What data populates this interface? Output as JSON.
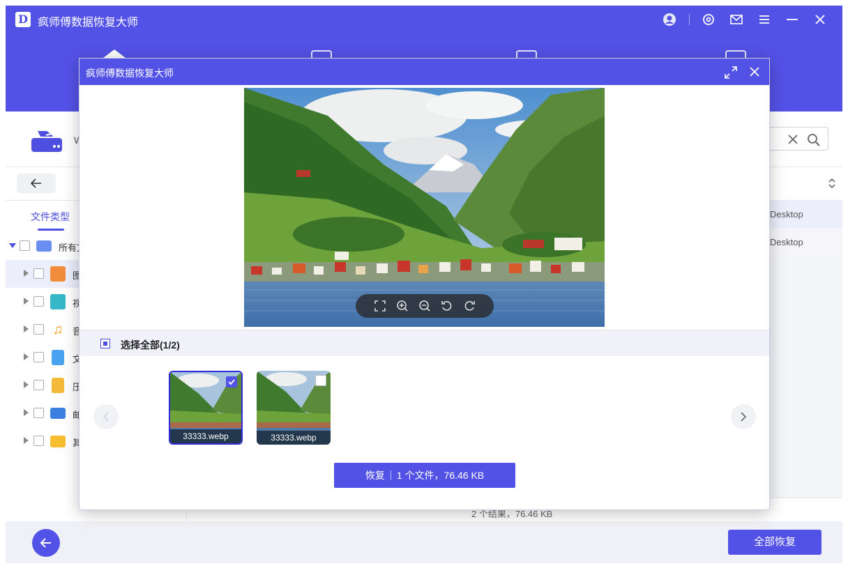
{
  "app": {
    "logo_letter": "D",
    "title": "疯师傅数据恢复大师"
  },
  "header": {
    "window_controls": [
      "account-icon",
      "settings-icon",
      "mail-icon",
      "menu-icon",
      "minimize-icon",
      "close-icon"
    ]
  },
  "path": {
    "drive_letter": "W"
  },
  "sidebar": {
    "tab_label": "文件类型",
    "root_label": "所有文",
    "items": [
      {
        "label": "图",
        "icon": "image-icon",
        "color": "#f08c3c"
      },
      {
        "label": "视",
        "icon": "video-icon",
        "color": "#36b8c8"
      },
      {
        "label": "音",
        "icon": "music-icon",
        "color": "#f5a623"
      },
      {
        "label": "文",
        "icon": "document-icon",
        "color": "#4aa3f0"
      },
      {
        "label": "压",
        "icon": "archive-icon",
        "color": "#f5b93a"
      },
      {
        "label": "邮",
        "icon": "mail-icon",
        "color": "#3b7fe0"
      },
      {
        "label": "其",
        "icon": "folder-icon",
        "color": "#f5bd2f"
      }
    ]
  },
  "list": {
    "rows": [
      {
        "path": "Desktop"
      },
      {
        "path": "Desktop"
      }
    ],
    "status": "2 个结果，76.46 KB"
  },
  "footer": {
    "recover_all_label": "全部恢复"
  },
  "modal": {
    "title": "疯师傅数据恢复大师",
    "select_all_label": "选择全部(1/2)",
    "thumbnails": [
      {
        "name": "33333.webp",
        "checked": true
      },
      {
        "name": "33333.webp",
        "checked": false
      }
    ],
    "recover_label": "恢复",
    "recover_info": "1 个文件，76.46 KB",
    "zoom_tools": [
      "fit-icon",
      "zoom-in-icon",
      "zoom-out-icon",
      "rotate-left-icon",
      "rotate-right-icon"
    ]
  },
  "colors": {
    "accent": "#5352e6",
    "selected_bg": "#eceefc"
  }
}
